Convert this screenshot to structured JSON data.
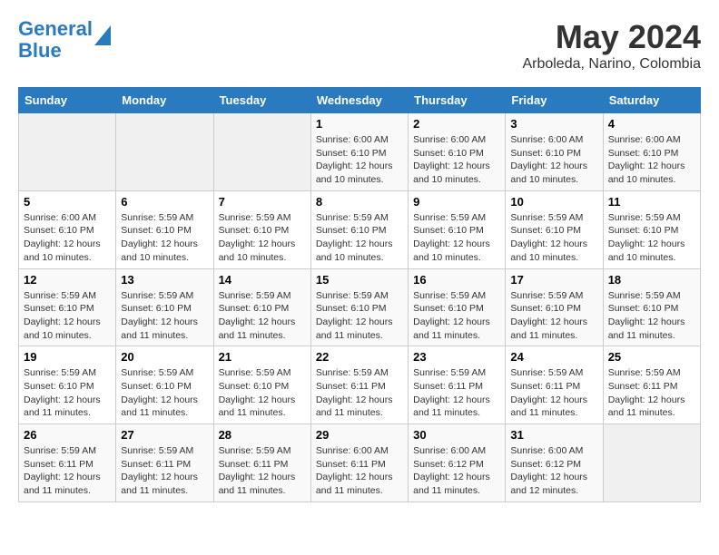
{
  "header": {
    "logo_line1": "General",
    "logo_line2": "Blue",
    "month_title": "May 2024",
    "location": "Arboleda, Narino, Colombia"
  },
  "calendar": {
    "days_of_week": [
      "Sunday",
      "Monday",
      "Tuesday",
      "Wednesday",
      "Thursday",
      "Friday",
      "Saturday"
    ],
    "weeks": [
      [
        {
          "day": "",
          "info": ""
        },
        {
          "day": "",
          "info": ""
        },
        {
          "day": "",
          "info": ""
        },
        {
          "day": "1",
          "info": "Sunrise: 6:00 AM\nSunset: 6:10 PM\nDaylight: 12 hours\nand 10 minutes."
        },
        {
          "day": "2",
          "info": "Sunrise: 6:00 AM\nSunset: 6:10 PM\nDaylight: 12 hours\nand 10 minutes."
        },
        {
          "day": "3",
          "info": "Sunrise: 6:00 AM\nSunset: 6:10 PM\nDaylight: 12 hours\nand 10 minutes."
        },
        {
          "day": "4",
          "info": "Sunrise: 6:00 AM\nSunset: 6:10 PM\nDaylight: 12 hours\nand 10 minutes."
        }
      ],
      [
        {
          "day": "5",
          "info": "Sunrise: 6:00 AM\nSunset: 6:10 PM\nDaylight: 12 hours\nand 10 minutes."
        },
        {
          "day": "6",
          "info": "Sunrise: 5:59 AM\nSunset: 6:10 PM\nDaylight: 12 hours\nand 10 minutes."
        },
        {
          "day": "7",
          "info": "Sunrise: 5:59 AM\nSunset: 6:10 PM\nDaylight: 12 hours\nand 10 minutes."
        },
        {
          "day": "8",
          "info": "Sunrise: 5:59 AM\nSunset: 6:10 PM\nDaylight: 12 hours\nand 10 minutes."
        },
        {
          "day": "9",
          "info": "Sunrise: 5:59 AM\nSunset: 6:10 PM\nDaylight: 12 hours\nand 10 minutes."
        },
        {
          "day": "10",
          "info": "Sunrise: 5:59 AM\nSunset: 6:10 PM\nDaylight: 12 hours\nand 10 minutes."
        },
        {
          "day": "11",
          "info": "Sunrise: 5:59 AM\nSunset: 6:10 PM\nDaylight: 12 hours\nand 10 minutes."
        }
      ],
      [
        {
          "day": "12",
          "info": "Sunrise: 5:59 AM\nSunset: 6:10 PM\nDaylight: 12 hours\nand 10 minutes."
        },
        {
          "day": "13",
          "info": "Sunrise: 5:59 AM\nSunset: 6:10 PM\nDaylight: 12 hours\nand 11 minutes."
        },
        {
          "day": "14",
          "info": "Sunrise: 5:59 AM\nSunset: 6:10 PM\nDaylight: 12 hours\nand 11 minutes."
        },
        {
          "day": "15",
          "info": "Sunrise: 5:59 AM\nSunset: 6:10 PM\nDaylight: 12 hours\nand 11 minutes."
        },
        {
          "day": "16",
          "info": "Sunrise: 5:59 AM\nSunset: 6:10 PM\nDaylight: 12 hours\nand 11 minutes."
        },
        {
          "day": "17",
          "info": "Sunrise: 5:59 AM\nSunset: 6:10 PM\nDaylight: 12 hours\nand 11 minutes."
        },
        {
          "day": "18",
          "info": "Sunrise: 5:59 AM\nSunset: 6:10 PM\nDaylight: 12 hours\nand 11 minutes."
        }
      ],
      [
        {
          "day": "19",
          "info": "Sunrise: 5:59 AM\nSunset: 6:10 PM\nDaylight: 12 hours\nand 11 minutes."
        },
        {
          "day": "20",
          "info": "Sunrise: 5:59 AM\nSunset: 6:10 PM\nDaylight: 12 hours\nand 11 minutes."
        },
        {
          "day": "21",
          "info": "Sunrise: 5:59 AM\nSunset: 6:10 PM\nDaylight: 12 hours\nand 11 minutes."
        },
        {
          "day": "22",
          "info": "Sunrise: 5:59 AM\nSunset: 6:11 PM\nDaylight: 12 hours\nand 11 minutes."
        },
        {
          "day": "23",
          "info": "Sunrise: 5:59 AM\nSunset: 6:11 PM\nDaylight: 12 hours\nand 11 minutes."
        },
        {
          "day": "24",
          "info": "Sunrise: 5:59 AM\nSunset: 6:11 PM\nDaylight: 12 hours\nand 11 minutes."
        },
        {
          "day": "25",
          "info": "Sunrise: 5:59 AM\nSunset: 6:11 PM\nDaylight: 12 hours\nand 11 minutes."
        }
      ],
      [
        {
          "day": "26",
          "info": "Sunrise: 5:59 AM\nSunset: 6:11 PM\nDaylight: 12 hours\nand 11 minutes."
        },
        {
          "day": "27",
          "info": "Sunrise: 5:59 AM\nSunset: 6:11 PM\nDaylight: 12 hours\nand 11 minutes."
        },
        {
          "day": "28",
          "info": "Sunrise: 5:59 AM\nSunset: 6:11 PM\nDaylight: 12 hours\nand 11 minutes."
        },
        {
          "day": "29",
          "info": "Sunrise: 6:00 AM\nSunset: 6:11 PM\nDaylight: 12 hours\nand 11 minutes."
        },
        {
          "day": "30",
          "info": "Sunrise: 6:00 AM\nSunset: 6:12 PM\nDaylight: 12 hours\nand 11 minutes."
        },
        {
          "day": "31",
          "info": "Sunrise: 6:00 AM\nSunset: 6:12 PM\nDaylight: 12 hours\nand 12 minutes."
        },
        {
          "day": "",
          "info": ""
        }
      ]
    ]
  }
}
